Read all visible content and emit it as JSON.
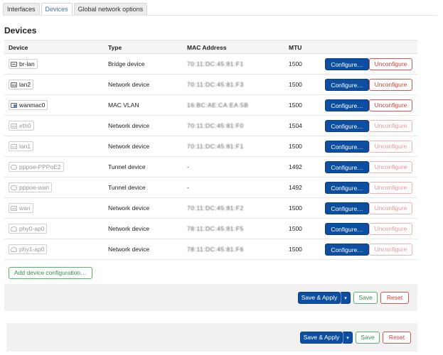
{
  "tabs": [
    {
      "label": "Interfaces",
      "active": false
    },
    {
      "label": "Devices",
      "active": true
    },
    {
      "label": "Global network options",
      "active": false
    }
  ],
  "page_title": "Devices",
  "table": {
    "headers": [
      "Device",
      "Type",
      "MAC Address",
      "MTU"
    ],
    "rows": [
      {
        "device": "br-lan",
        "icon": "bridge-icon",
        "type": "Bridge device",
        "mac": "70:11:DC:45:81:F1",
        "mtu": "1500",
        "dim": false
      },
      {
        "device": "lan2",
        "icon": "ethernet-icon",
        "type": "Network device",
        "mac": "70:11:DC:45:81:F3",
        "mtu": "1500",
        "dim": false
      },
      {
        "device": "wanmac0",
        "icon": "macvlan-icon",
        "type": "MAC VLAN",
        "mac": "16:BC:AE:CA:EA:5B",
        "mtu": "1500",
        "dim": false
      },
      {
        "device": "eth0",
        "icon": "ethernet-icon",
        "type": "Network device",
        "mac": "70:11:DC:45:81:F0",
        "mtu": "1504",
        "dim": true
      },
      {
        "device": "lan1",
        "icon": "ethernet-icon",
        "type": "Network device",
        "mac": "70:11:DC:45:81:F1",
        "mtu": "1500",
        "dim": true
      },
      {
        "device": "pppoe-PPPoE2",
        "icon": "tunnel-icon",
        "type": "Tunnel device",
        "mac": "-",
        "mtu": "1492",
        "dim": true
      },
      {
        "device": "pppoe-wan",
        "icon": "tunnel-icon",
        "type": "Tunnel device",
        "mac": "-",
        "mtu": "1492",
        "dim": true
      },
      {
        "device": "wan",
        "icon": "ethernet-icon",
        "type": "Network device",
        "mac": "70:11:DC:45:81:F2",
        "mtu": "1500",
        "dim": true
      },
      {
        "device": "phy0-ap0",
        "icon": "wifi-icon",
        "type": "Network device",
        "mac": "78:11:DC:45:81:F5",
        "mtu": "1500",
        "dim": true
      },
      {
        "device": "phy1-ap0",
        "icon": "wifi-icon",
        "type": "Network device",
        "mac": "78:11:DC:45:81:F6",
        "mtu": "1500",
        "dim": true
      }
    ],
    "configure_label": "Configure…",
    "unconfigure_label": "Unconfigure"
  },
  "add_device_label": "Add device configuration…",
  "footer": {
    "save_apply_label": "Save & Apply",
    "save_label": "Save",
    "reset_label": "Reset"
  },
  "colors": {
    "primary": "#0c4ea2",
    "danger": "#d9534f",
    "success": "#58b36b",
    "tab_active": "#3a75b4"
  }
}
